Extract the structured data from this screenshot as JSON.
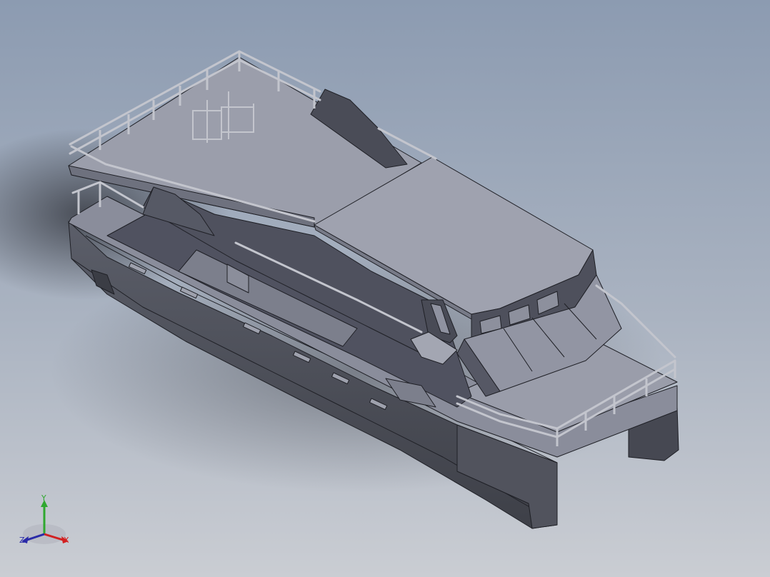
{
  "viewport": {
    "background_top": "#8f9db2",
    "background_bottom": "#c9ccd2",
    "model_face_light": "#9699a8",
    "model_face_dark": "#4c4e57",
    "model_edge": "#1f2026",
    "railing": "#c2c4cc"
  },
  "triad": {
    "y_label": "Y",
    "x_label": "X",
    "z_label": "Z",
    "y_color": "#2fa82f",
    "x_color": "#d22020",
    "z_color": "#2a2aa8"
  }
}
